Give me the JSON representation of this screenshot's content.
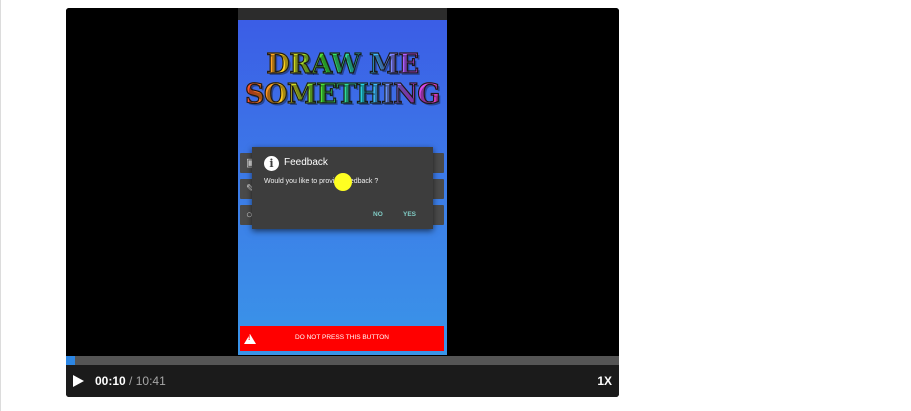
{
  "app": {
    "title_lines": [
      "DRAW ME",
      "SOMETHING"
    ],
    "dialog": {
      "title": "Feedback",
      "message": "Would you like to provide feedback ?",
      "no_label": "NO",
      "yes_label": "YES",
      "icon": "info-icon"
    },
    "danger_button": {
      "label": "DO NOT PRESS THIS BUTTON",
      "icon": "warning-icon",
      "color": "#ff0000"
    }
  },
  "player": {
    "current_time": "00:10",
    "separator": "/",
    "duration": "10:41",
    "speed": "1X",
    "progress_fraction": 0.016,
    "progress_color": "#2c86e4",
    "play_icon": "play-icon"
  }
}
